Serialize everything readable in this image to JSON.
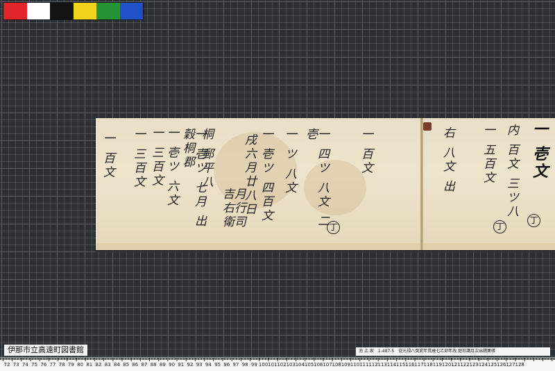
{
  "color_bar": {
    "swatches": [
      "#e3262b",
      "#ffffff",
      "#141414",
      "#f2d41a",
      "#239335",
      "#2250c8"
    ]
  },
  "library_label": "伊那市立高遠町図書館",
  "catalog_info": {
    "collection": "池 上 家",
    "number": "1-487-5",
    "title": "従元禄八癸亥年貫歳七乙卯年改 廻日講月次出銭集帳"
  },
  "ruler": {
    "labels": [
      "72",
      "73",
      "74",
      "75",
      "76",
      "77",
      "78",
      "79",
      "80",
      "81",
      "82",
      "83",
      "84",
      "85",
      "86",
      "87",
      "88",
      "89",
      "90",
      "91",
      "92",
      "93",
      "94",
      "95",
      "96",
      "97",
      "98",
      "99",
      "100",
      "101",
      "102",
      "103",
      "104",
      "105",
      "106",
      "107",
      "108",
      "109",
      "110",
      "111",
      "112",
      "113",
      "114",
      "115",
      "116",
      "117",
      "118",
      "119",
      "120",
      "121",
      "122",
      "123",
      "124",
      "125",
      "126",
      "127",
      "128"
    ]
  },
  "document": {
    "columns_left": [
      {
        "text": "一 百文",
        "style": "normal"
      },
      {
        "text": "一 四ツ 八文 二 壱",
        "style": "normal"
      },
      {
        "text": "一 ツ 八文",
        "style": "normal"
      },
      {
        "text": "桐 郵平八",
        "style": "normal"
      },
      {
        "text": "一 壱ツ 四百文",
        "style": "normal"
      },
      {
        "text": "戌六月廿八日",
        "style": "normal"
      },
      {
        "text": "月行司 吉右衛",
        "style": "normal"
      },
      {
        "text": "一 壱ツ 七月 出穀桐郡",
        "style": "normal"
      },
      {
        "text": "一 壱ツ 六文",
        "style": "normal"
      },
      {
        "text": "一 三百文",
        "style": "normal"
      },
      {
        "text": "一 三百文",
        "style": "normal"
      },
      {
        "text": "一 百文",
        "style": "normal"
      }
    ],
    "columns_right": [
      {
        "text": "一 壱文",
        "style": "big"
      },
      {
        "text": "内 百文 三ツ八",
        "style": "normal"
      },
      {
        "text": "一 五百文",
        "style": "normal"
      },
      {
        "text": "右 八文 出",
        "style": "normal"
      }
    ],
    "circle_marks": [
      "丁",
      "丁",
      "丁"
    ],
    "page_number_mark": "弐"
  }
}
